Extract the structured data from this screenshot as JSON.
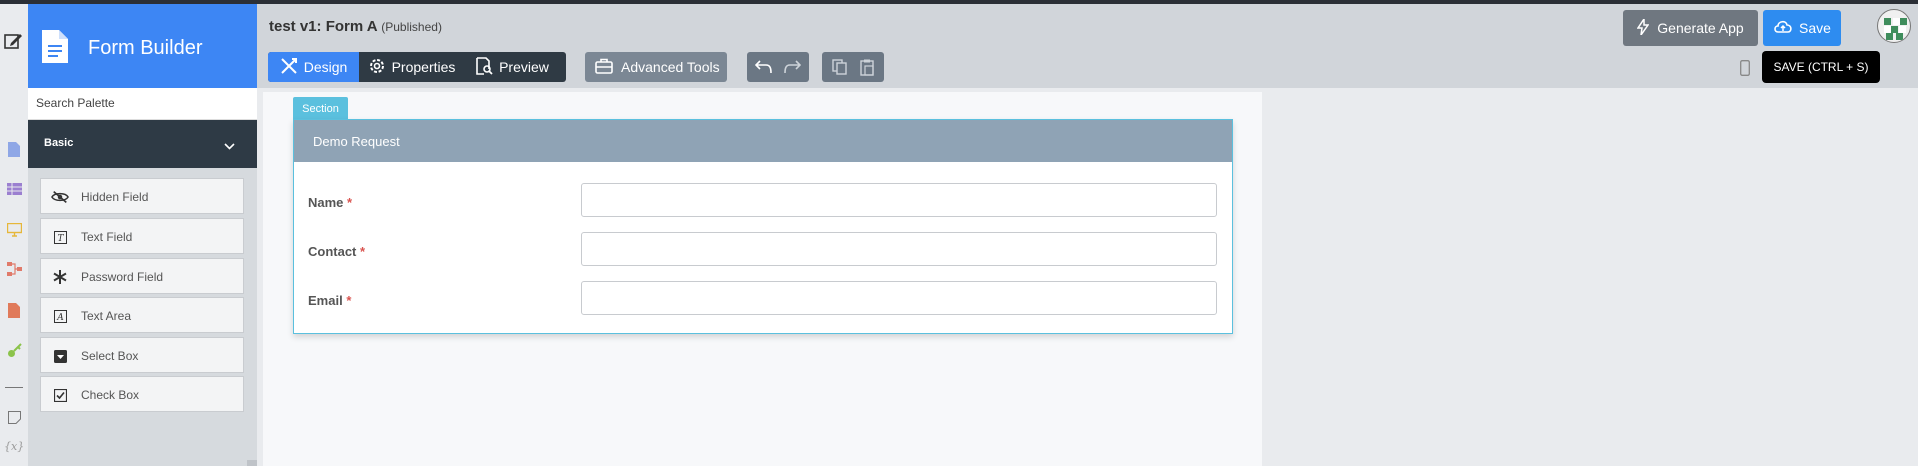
{
  "app": {
    "title": "Form Builder"
  },
  "form": {
    "name": "test v1: Form A",
    "status": "(Published)"
  },
  "toolbar": {
    "design": "Design",
    "properties": "Properties",
    "preview": "Preview",
    "advanced_tools": "Advanced Tools",
    "generate_app": "Generate App",
    "save": "Save",
    "save_tooltip": "SAVE (CTRL + S)"
  },
  "palette": {
    "search_placeholder": "Search Palette",
    "group": "Basic",
    "items": [
      {
        "label": "Hidden Field",
        "icon": "eye-slash-icon"
      },
      {
        "label": "Text Field",
        "icon": "text-field-icon"
      },
      {
        "label": "Password Field",
        "icon": "asterisk-icon"
      },
      {
        "label": "Text Area",
        "icon": "text-area-icon"
      },
      {
        "label": "Select Box",
        "icon": "select-box-icon"
      },
      {
        "label": "Check Box",
        "icon": "checkbox-icon"
      }
    ]
  },
  "canvas": {
    "section_tag": "Section",
    "section_title": "Demo Request",
    "fields": [
      {
        "label": "Name",
        "required": "*"
      },
      {
        "label": "Contact",
        "required": "*"
      },
      {
        "label": "Email",
        "required": "*"
      }
    ]
  },
  "colors": {
    "accent": "#3d86f4",
    "section": "#5bc0de",
    "required": "#d9534f"
  }
}
